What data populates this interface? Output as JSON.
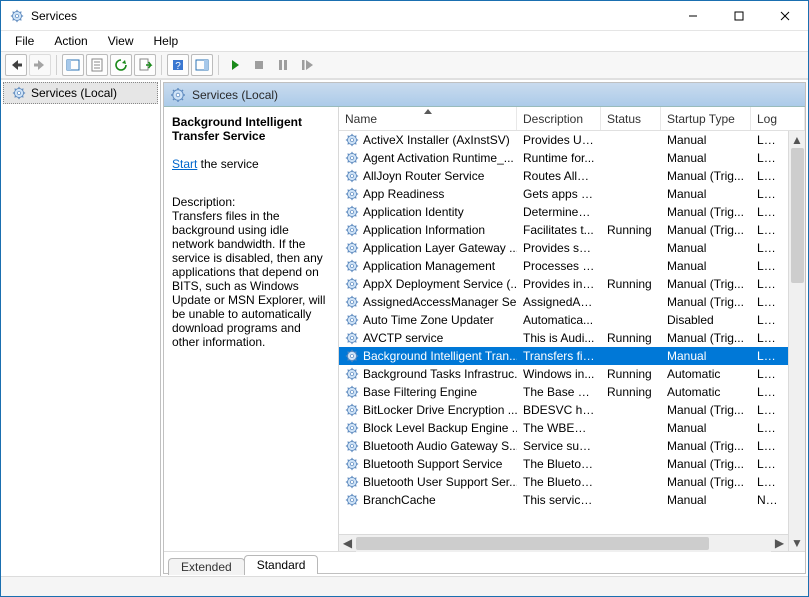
{
  "window": {
    "title": "Services"
  },
  "menu": {
    "file": "File",
    "action": "Action",
    "view": "View",
    "help": "Help"
  },
  "tree": {
    "root": "Services (Local)"
  },
  "header": {
    "title": "Services (Local)"
  },
  "detail": {
    "name": "Background Intelligent Transfer Service",
    "action_link": "Start",
    "action_suffix": " the service",
    "desc_heading": "Description:",
    "desc_body": "Transfers files in the background using idle network bandwidth. If the service is disabled, then any applications that depend on BITS, such as Windows Update or MSN Explorer, will be unable to automatically download programs and other information."
  },
  "columns": {
    "name": "Name",
    "description": "Description",
    "status": "Status",
    "startup": "Startup Type",
    "logon": "Log"
  },
  "tabs": {
    "extended": "Extended",
    "standard": "Standard"
  },
  "services": [
    {
      "name": "ActiveX Installer (AxInstSV)",
      "desc": "Provides Us...",
      "status": "",
      "startup": "Manual",
      "logon": "Loca",
      "sel": false
    },
    {
      "name": "Agent Activation Runtime_...",
      "desc": "Runtime for...",
      "status": "",
      "startup": "Manual",
      "logon": "Loca",
      "sel": false
    },
    {
      "name": "AllJoyn Router Service",
      "desc": "Routes AllJo...",
      "status": "",
      "startup": "Manual (Trig...",
      "logon": "Loca",
      "sel": false
    },
    {
      "name": "App Readiness",
      "desc": "Gets apps re...",
      "status": "",
      "startup": "Manual",
      "logon": "Loca",
      "sel": false
    },
    {
      "name": "Application Identity",
      "desc": "Determines ...",
      "status": "",
      "startup": "Manual (Trig...",
      "logon": "Loca",
      "sel": false
    },
    {
      "name": "Application Information",
      "desc": "Facilitates t...",
      "status": "Running",
      "startup": "Manual (Trig...",
      "logon": "Loca",
      "sel": false
    },
    {
      "name": "Application Layer Gateway ...",
      "desc": "Provides su...",
      "status": "",
      "startup": "Manual",
      "logon": "Loca",
      "sel": false
    },
    {
      "name": "Application Management",
      "desc": "Processes in...",
      "status": "",
      "startup": "Manual",
      "logon": "Loca",
      "sel": false
    },
    {
      "name": "AppX Deployment Service (...",
      "desc": "Provides inf...",
      "status": "Running",
      "startup": "Manual (Trig...",
      "logon": "Loca",
      "sel": false
    },
    {
      "name": "AssignedAccessManager Se...",
      "desc": "AssignedAc...",
      "status": "",
      "startup": "Manual (Trig...",
      "logon": "Loca",
      "sel": false
    },
    {
      "name": "Auto Time Zone Updater",
      "desc": "Automatica...",
      "status": "",
      "startup": "Disabled",
      "logon": "Loca",
      "sel": false
    },
    {
      "name": "AVCTP service",
      "desc": "This is Audi...",
      "status": "Running",
      "startup": "Manual (Trig...",
      "logon": "Loca",
      "sel": false
    },
    {
      "name": "Background Intelligent Tran...",
      "desc": "Transfers fil...",
      "status": "",
      "startup": "Manual",
      "logon": "Loca",
      "sel": true
    },
    {
      "name": "Background Tasks Infrastruc...",
      "desc": "Windows in...",
      "status": "Running",
      "startup": "Automatic",
      "logon": "Loca",
      "sel": false
    },
    {
      "name": "Base Filtering Engine",
      "desc": "The Base Fil...",
      "status": "Running",
      "startup": "Automatic",
      "logon": "Loca",
      "sel": false
    },
    {
      "name": "BitLocker Drive Encryption ...",
      "desc": "BDESVC hos...",
      "status": "",
      "startup": "Manual (Trig...",
      "logon": "Loca",
      "sel": false
    },
    {
      "name": "Block Level Backup Engine ...",
      "desc": "The WBENG...",
      "status": "",
      "startup": "Manual",
      "logon": "Loca",
      "sel": false
    },
    {
      "name": "Bluetooth Audio Gateway S...",
      "desc": "Service sup...",
      "status": "",
      "startup": "Manual (Trig...",
      "logon": "Loca",
      "sel": false
    },
    {
      "name": "Bluetooth Support Service",
      "desc": "The Bluetoo...",
      "status": "",
      "startup": "Manual (Trig...",
      "logon": "Loca",
      "sel": false
    },
    {
      "name": "Bluetooth User Support Ser...",
      "desc": "The Bluetoo...",
      "status": "",
      "startup": "Manual (Trig...",
      "logon": "Loca",
      "sel": false
    },
    {
      "name": "BranchCache",
      "desc": "This service ...",
      "status": "",
      "startup": "Manual",
      "logon": "Netw",
      "sel": false
    }
  ]
}
